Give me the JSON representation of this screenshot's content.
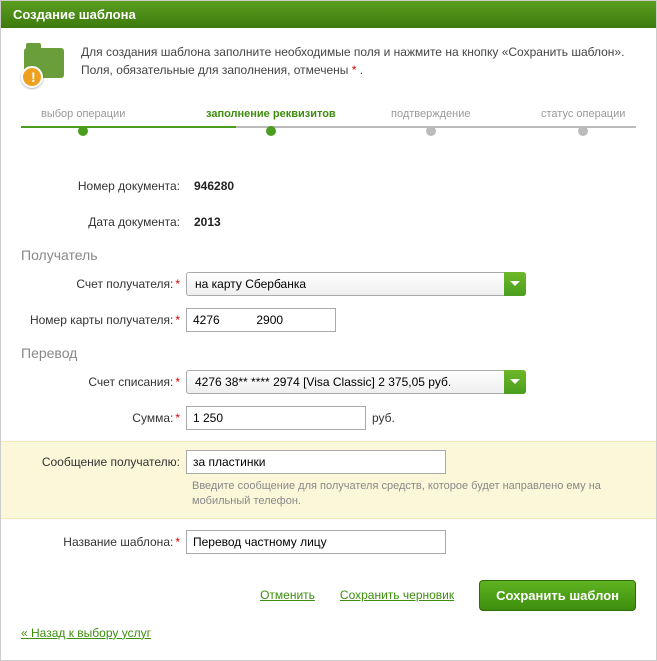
{
  "title": "Создание шаблона",
  "intro": {
    "line1": "Для создания шаблона заполните необходимые поля и нажмите на кнопку «Сохранить шаблон».",
    "line2a": "Поля, обязательные для заполнения, отмечены ",
    "line2b": " ."
  },
  "wizard": {
    "step1": "выбор операции",
    "step2": "заполнение реквизитов",
    "step3": "подтверждение",
    "step4": "статус операции"
  },
  "fields": {
    "docnum_label": "Номер документа:",
    "docnum_value": "946280",
    "docdate_label": "Дата документа:",
    "docdate_value": "2013",
    "recipient_section": "Получатель",
    "recip_account_label": "Счет получателя:",
    "recip_account_value": "на карту Сбербанка",
    "recip_card_label": "Номер карты получателя:",
    "recip_card_value": "4276           2900",
    "transfer_section": "Перевод",
    "debit_account_label": "Счет списания:",
    "debit_account_value": "4276 38** **** 2974  [Visa Classic] 2 375,05  руб.",
    "amount_label": "Сумма:",
    "amount_value": "1 250",
    "amount_suffix": "руб.",
    "message_label": "Сообщение получателю:",
    "message_value": "за пластинки",
    "message_hint": "Введите сообщение для получателя средств, которое будет направлено ему на мобильный телефон.",
    "template_name_label": "Название шаблона:",
    "template_name_value": "Перевод частному лицу"
  },
  "actions": {
    "cancel": "Отменить",
    "draft": "Сохранить черновик",
    "save": "Сохранить шаблон"
  },
  "back_link": "« Назад к выбору услуг"
}
